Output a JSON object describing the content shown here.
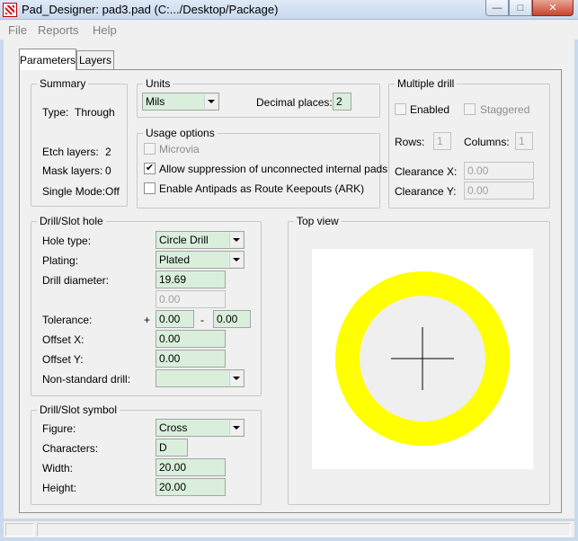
{
  "window": {
    "title": "Pad_Designer: pad3.pad (C:.../Desktop/Package)",
    "min_glyph": "—",
    "max_glyph": "□",
    "close_glyph": "✕"
  },
  "menu": {
    "file": "File",
    "reports": "Reports",
    "help": "Help"
  },
  "tabs": {
    "parameters": "Parameters",
    "layers": "Layers"
  },
  "summary": {
    "title": "Summary",
    "type_label": "Type:",
    "type_value": "Through",
    "etch_label": "Etch layers:",
    "etch_value": "2",
    "mask_label": "Mask layers:",
    "mask_value": "0",
    "single_label": "Single Mode:",
    "single_value": "Off"
  },
  "units": {
    "title": "Units",
    "value": "Mils",
    "decimal_label": "Decimal places:",
    "decimal_value": "2"
  },
  "usage": {
    "title": "Usage options",
    "microvia_label": "Microvia",
    "microvia_checked": false,
    "allow_label": "Allow suppression of unconnected internal pads",
    "allow_checked": true,
    "antipads_label": "Enable Antipads as Route Keepouts (ARK)",
    "antipads_checked": false,
    "check_mark": "✔"
  },
  "multiple_drill": {
    "title": "Multiple drill",
    "enabled_label": "Enabled",
    "staggered_label": "Staggered",
    "rows_label": "Rows:",
    "rows_value": "1",
    "columns_label": "Columns:",
    "columns_value": "1",
    "clearance_x_label": "Clearance X:",
    "clearance_x_value": "0.00",
    "clearance_y_label": "Clearance Y:",
    "clearance_y_value": "0.00"
  },
  "drill_hole": {
    "title": "Drill/Slot hole",
    "hole_type_label": "Hole type:",
    "hole_type_value": "Circle Drill",
    "plating_label": "Plating:",
    "plating_value": "Plated",
    "diameter_label": "Drill diameter:",
    "diameter_value": "19.69",
    "second_value": "0.00",
    "tolerance_label": "Tolerance:",
    "tol_plus_sign": "+",
    "tol_plus_value": "0.00",
    "tol_minus_sign": "-",
    "tol_minus_value": "0.00",
    "offset_x_label": "Offset X:",
    "offset_x_value": "0.00",
    "offset_y_label": "Offset Y:",
    "offset_y_value": "0.00",
    "nonstandard_label": "Non-standard drill:",
    "nonstandard_value": ""
  },
  "drill_symbol": {
    "title": "Drill/Slot symbol",
    "figure_label": "Figure:",
    "figure_value": "Cross",
    "characters_label": "Characters:",
    "characters_value": "D",
    "width_label": "Width:",
    "width_value": "20.00",
    "height_label": "Height:",
    "height_value": "20.00"
  },
  "top_view": {
    "title": "Top view",
    "pad_color": "#ffff00",
    "hole_color": "#efefef",
    "canvas_color": "#ffffff"
  }
}
